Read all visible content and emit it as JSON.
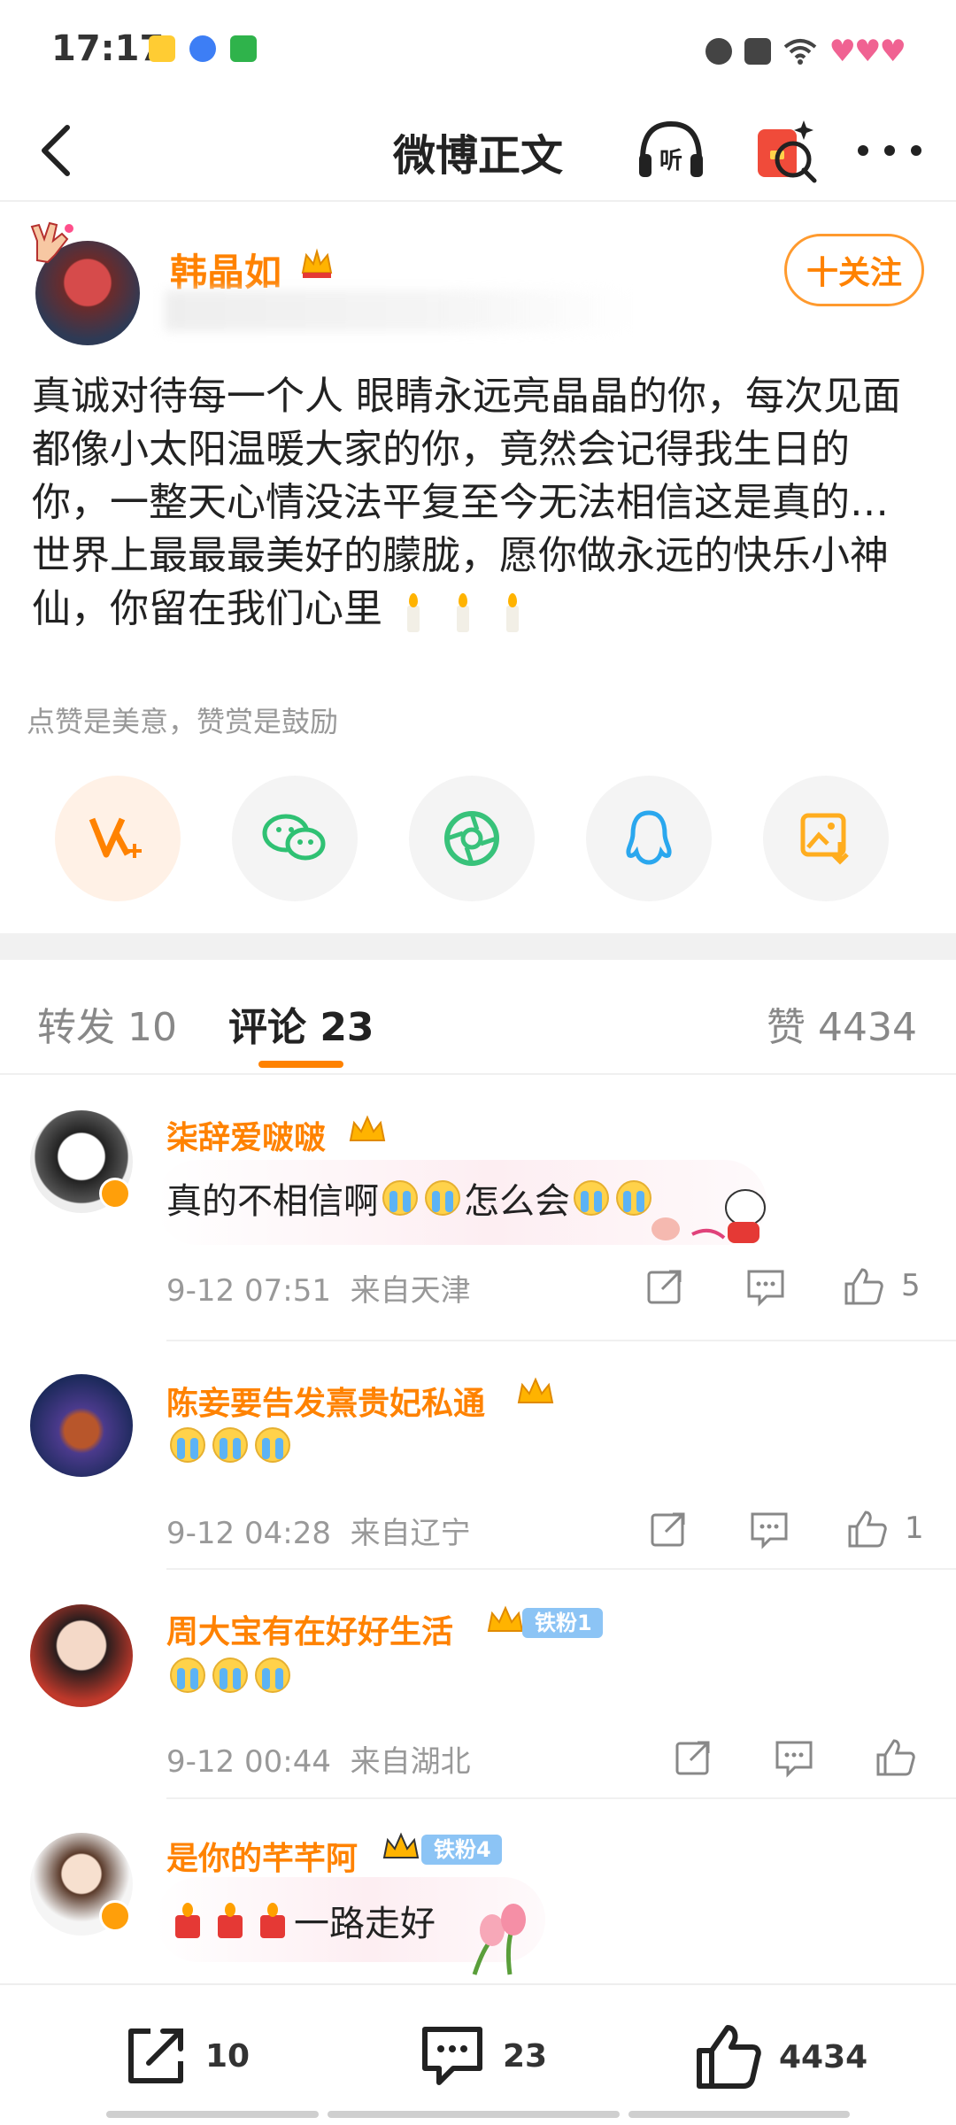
{
  "status_bar": {
    "time": "17:17",
    "app_icons": [
      "weibo-icon",
      "baidu-icon",
      "game-icon"
    ],
    "right_icons": [
      "alarm-icon",
      "nfc-off-icon",
      "wifi-icon",
      "hearts-icon"
    ],
    "hearts": "♥♥♥"
  },
  "nav": {
    "title": "微博正文",
    "listen_label": "听"
  },
  "post": {
    "author": "韩晶如",
    "follow_label": "十关注",
    "text": "真诚对待每一个人 眼睛永远亮晶晶的你，每次见面都像小太阳温暖大家的你，竟然会记得我生日的你，一整天心情没法平复至今无法相信这是真的…世界上最最最美好的朦胧，愿你做永远的快乐小神仙，你留在我们心里",
    "reward_hint": "点赞是美意，赞赏是鼓励"
  },
  "share_buttons": [
    "vplus-icon",
    "wechat-icon",
    "moments-icon",
    "qq-icon",
    "save-image-icon"
  ],
  "tabs": [
    {
      "label": "转发 10"
    },
    {
      "label": "评论 23"
    },
    {
      "label": "赞 4434"
    }
  ],
  "comments": [
    {
      "name": "柒辞爱啵啵",
      "text_a": "真的不相信啊",
      "text_b": "怎么会",
      "date": "9-12 07:51",
      "location": "来自天津",
      "likes": "5",
      "fan_badge": ""
    },
    {
      "name": "陈妾要告发熹贵妃私通",
      "text_a": "",
      "text_b": "",
      "date": "9-12 04:28",
      "location": "来自辽宁",
      "likes": "1",
      "fan_badge": ""
    },
    {
      "name": "周大宝有在好好生活",
      "text_a": "",
      "text_b": "",
      "date": "9-12 00:44",
      "location": "来自湖北",
      "likes": "",
      "fan_badge": "铁粉1"
    },
    {
      "name": "是你的芊芊阿",
      "text_a": "一路走好",
      "text_b": "",
      "date": "",
      "location": "",
      "likes": "",
      "fan_badge": "铁粉4"
    }
  ],
  "bottom_bar": {
    "repost_count": "10",
    "comment_count": "23",
    "like_count": "4434"
  },
  "colors": {
    "accent": "#ff8200",
    "fan_badge": "#8cc4f5",
    "muted_text": "#999999"
  }
}
